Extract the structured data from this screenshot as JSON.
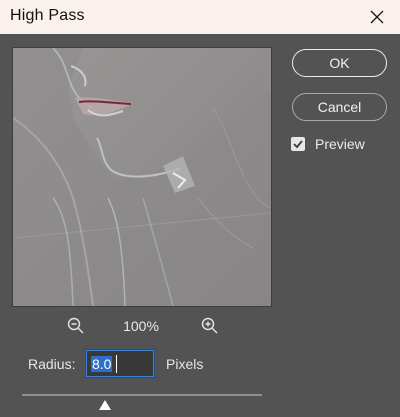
{
  "window": {
    "title": "High Pass"
  },
  "buttons": {
    "ok": "OK",
    "cancel": "Cancel"
  },
  "preview_toggle": {
    "label": "Preview",
    "checked": true
  },
  "zoom": {
    "level": "100%"
  },
  "radius": {
    "label": "Radius:",
    "value": "8.0",
    "unit": "Pixels",
    "slider_fraction": 0.35
  },
  "icons": {
    "close": "close-icon",
    "zoom_out": "zoom-out-icon",
    "zoom_in": "zoom-in-icon",
    "checkmark": "checkmark-icon",
    "slider_thumb": "triangle-up-icon"
  },
  "colors": {
    "title_bar": "#fbf1ec",
    "dialog_bg": "#535353",
    "preview_gray": "#8e8c8c",
    "focus_blue": "#3b83d6",
    "selection_blue": "#2e6fc7"
  }
}
